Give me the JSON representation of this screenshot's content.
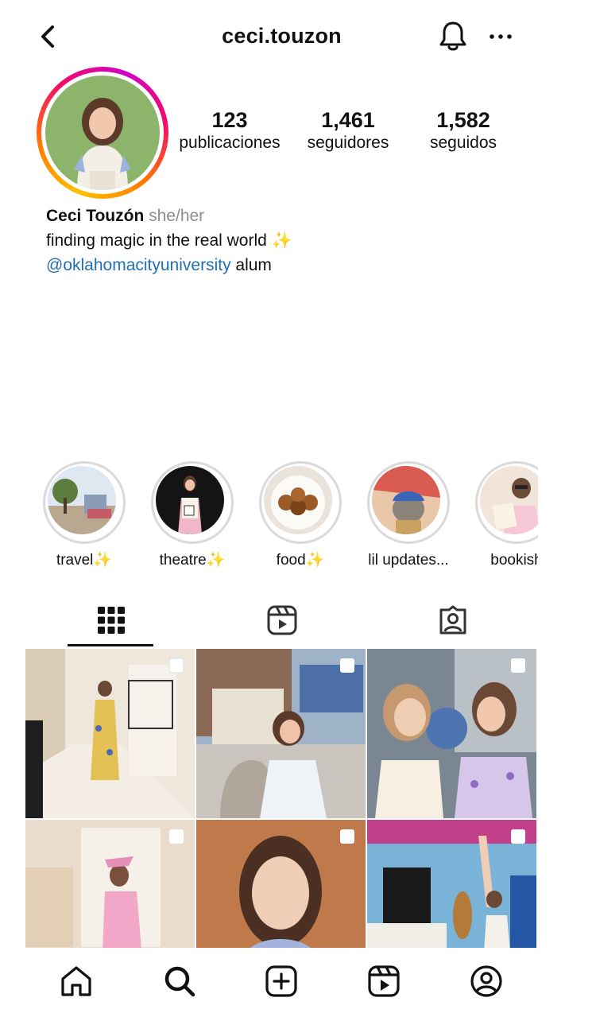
{
  "header": {
    "username": "ceci.touzon",
    "icons": [
      "back-arrow-icon",
      "bell-icon",
      "more-icon"
    ]
  },
  "stats": {
    "posts": {
      "value": "123",
      "label": "publicaciones"
    },
    "followers": {
      "value": "1,461",
      "label": "seguidores"
    },
    "following": {
      "value": "1,582",
      "label": "seguidos"
    }
  },
  "bio": {
    "name": "Ceci Touzón",
    "pronouns": "she/her",
    "line1": "finding magic in the real world ✨",
    "mention": "@oklahomacityuniversity",
    "line2_rest": " alum"
  },
  "highlights": [
    {
      "label": "travel✨",
      "icon": "travel-highlight"
    },
    {
      "label": "theatre✨",
      "icon": "theatre-highlight"
    },
    {
      "label": "food✨",
      "icon": "food-highlight"
    },
    {
      "label": "lil updates...",
      "icon": "updates-highlight"
    },
    {
      "label": "bookish",
      "icon": "bookish-highlight"
    }
  ],
  "tabs": [
    {
      "name": "posts-grid-tab",
      "icon": "grid-icon",
      "active": true
    },
    {
      "name": "reels-tab",
      "icon": "reels-icon",
      "active": false
    },
    {
      "name": "tagged-tab",
      "icon": "tagged-user-icon",
      "active": false
    }
  ],
  "bottom_nav": [
    "home-icon",
    "search-icon",
    "create-post-icon",
    "reels-icon",
    "profile-icon"
  ],
  "colors": {
    "mention": "#1f6fb5",
    "pronouns": "#8e8e8e",
    "story_ring": [
      "#ffc200",
      "#ff7a00",
      "#f00a6a",
      "#d300c5"
    ],
    "highlight_ring": "#dadada"
  }
}
